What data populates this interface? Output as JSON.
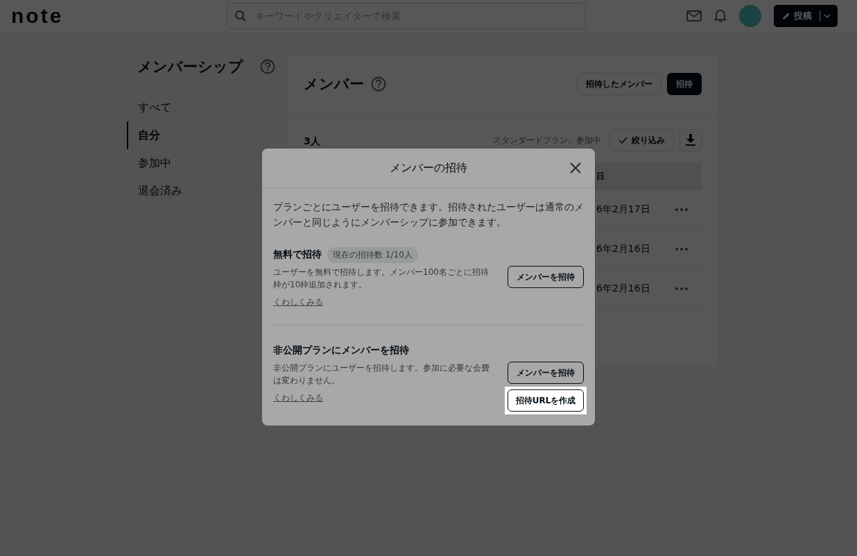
{
  "header": {
    "logo": "note",
    "search": {
      "placeholder": "キーワードやクリエイターで検索"
    },
    "post_button": "投稿"
  },
  "sidebar": {
    "title": "メンバーシップ",
    "items": [
      {
        "label": "すべて",
        "selected": false
      },
      {
        "label": "自分",
        "selected": true
      },
      {
        "label": "参加中",
        "selected": false
      },
      {
        "label": "退会済み",
        "selected": false
      }
    ]
  },
  "main": {
    "title": "メンバー",
    "buttons": [
      {
        "label": "招待したメンバー",
        "kind": "outline"
      },
      {
        "label": "招待",
        "kind": "filled"
      }
    ],
    "count": "3人",
    "filter_summary": "スタンダードプラン、参加中",
    "filter_button": "絞り込み",
    "table": {
      "columns": [
        "日"
      ],
      "rows": [
        {
          "date": "6年2月17日"
        },
        {
          "date": "6年2月16日"
        },
        {
          "date": "6年2月16日"
        }
      ]
    }
  },
  "modal": {
    "title": "メンバーの招待",
    "description": "プランごとにユーザーを招待できます。招待されたユーザーは通常のメンバーと同じようにメンバーシップに参加できます。",
    "sections": [
      {
        "title": "無料で招待",
        "badge": "現在の招待数 1/10人",
        "description": "ユーザーを無料で招待します。メンバー100名ごとに招待枠が10枠追加されます。",
        "link": "くわしくみる",
        "buttons": [
          {
            "label": "メンバーを招待",
            "spotlight": false
          }
        ]
      },
      {
        "title": "非公開プランにメンバーを招待",
        "description": "非公開プランにユーザーを招待します。参加に必要な会費は変わりません。",
        "link": "くわしくみる",
        "buttons": [
          {
            "label": "メンバーを招待",
            "spotlight": false
          },
          {
            "label": "招待URLを作成",
            "spotlight": true
          }
        ]
      }
    ]
  }
}
